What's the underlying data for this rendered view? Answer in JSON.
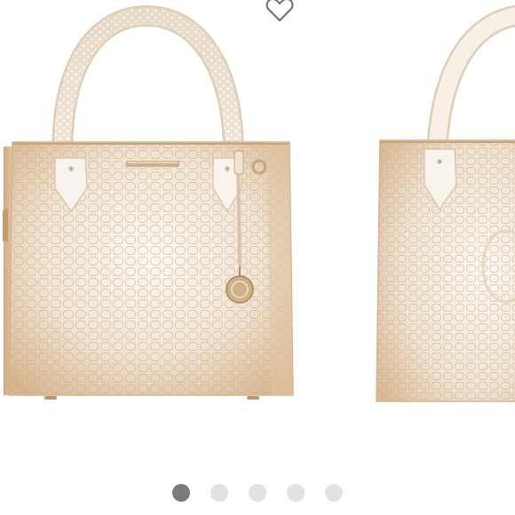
{
  "icons": {
    "favorite": "heart-outline-icon"
  },
  "colors": {
    "dot_active": "#7a7a7a",
    "dot_inactive": "#e2e2e2",
    "leather_light": "#f4efe7",
    "leather_tan": "#d9b892"
  },
  "carousel": {
    "total_slides": 5,
    "active_index": 0
  }
}
